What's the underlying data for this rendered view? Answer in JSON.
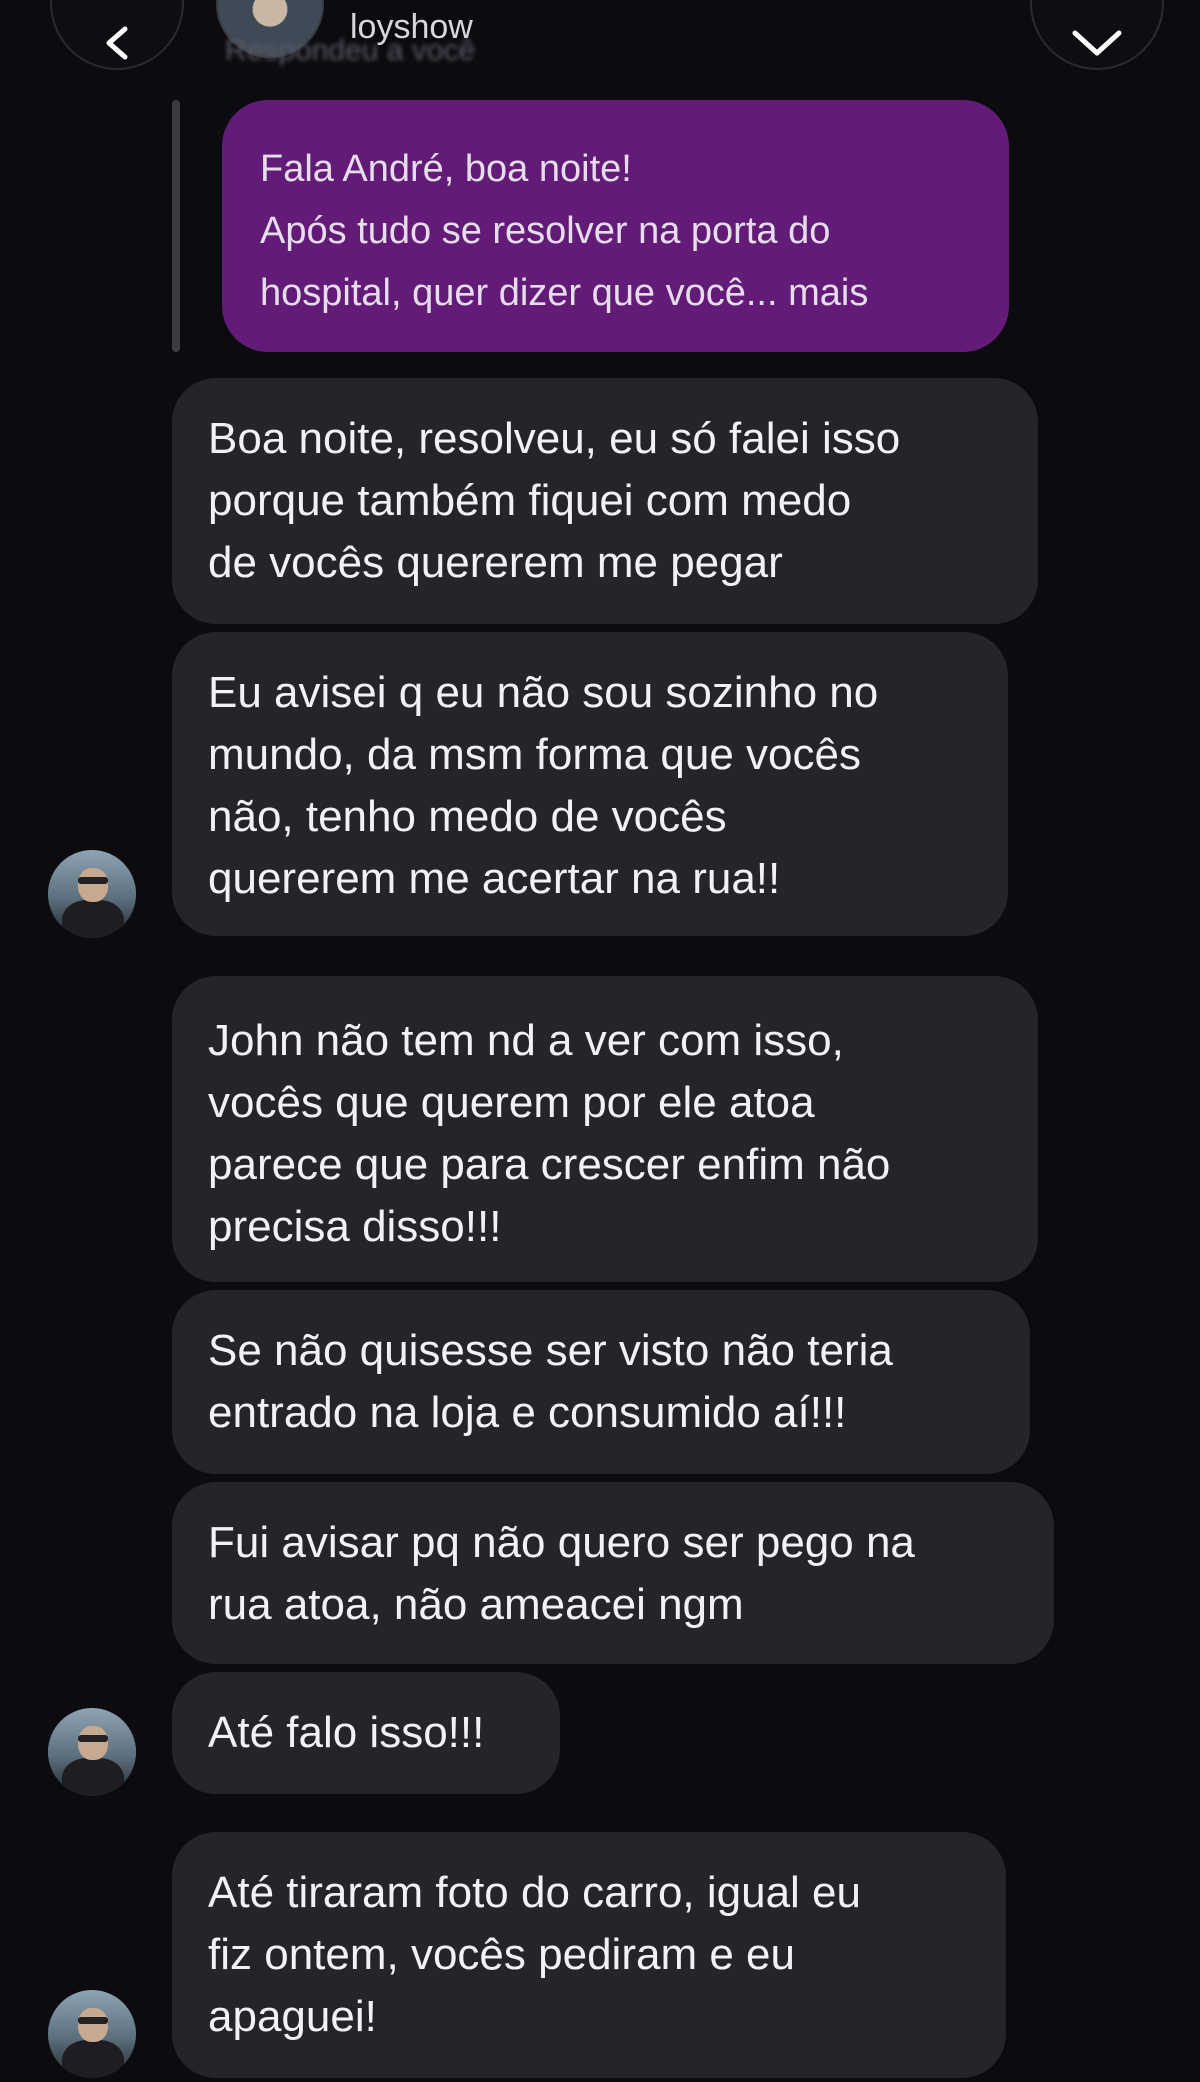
{
  "header": {
    "username": "loyshow",
    "replied_label": "Respondeu a você",
    "back_icon": "chevron-left-icon",
    "menu_icon": "chevron-down-icon"
  },
  "quoted_message": {
    "lines": [
      "Fala André, boa noite!",
      "Após tudo se resolver na porta do",
      "hospital, quer dizer que você... mais"
    ]
  },
  "messages": [
    {
      "lines": [
        "Boa noite, resolveu, eu só falei isso",
        "porque também fiquei com medo",
        "de vocês quererem me pegar"
      ]
    },
    {
      "lines": [
        "Eu avisei q eu não sou sozinho no",
        "mundo, da msm forma que vocês",
        "não, tenho medo de vocês",
        "quererem me acertar na rua!!"
      ]
    },
    {
      "lines": [
        "John não tem nd a ver com isso,",
        "vocês que querem por ele atoa",
        "parece que para crescer enfim não",
        "precisa disso!!!"
      ]
    },
    {
      "lines": [
        "Se não quisesse ser visto não teria",
        "entrado na loja e consumido aí!!!"
      ]
    },
    {
      "lines": [
        "Fui avisar pq não quero ser pego na",
        "rua atoa, não ameacei ngm"
      ]
    },
    {
      "lines": [
        "Até falo isso!!!"
      ]
    },
    {
      "lines": [
        "Até tiraram foto do carro, igual eu",
        "fiz ontem, vocês pediram e eu",
        "apaguei!"
      ]
    }
  ],
  "colors": {
    "background": "#0b0b10",
    "incoming_bubble": "#24242b",
    "quoted_bubble": "#621c78"
  }
}
